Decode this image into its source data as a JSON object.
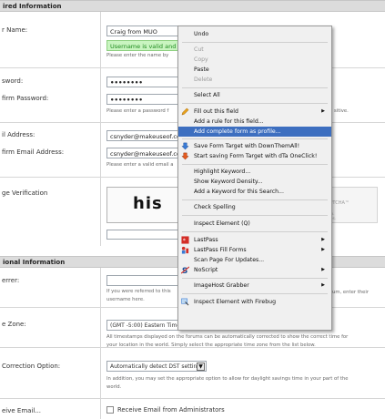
{
  "sections": {
    "required": "ired Information",
    "optional": "ional Information"
  },
  "fields": {
    "username": {
      "label": "r Name:",
      "value": "Craig from MUO",
      "valid": "Username is valid and",
      "hint": "Please enter the name by"
    },
    "password": {
      "label": "sword:",
      "value": "••••••••",
      "confirm_label": "firm Password:",
      "confirm_value": "••••••••",
      "hint": "Please enter a password f",
      "right_hint": "sitive."
    },
    "email": {
      "label": "il Address:",
      "value": "csnyder@makeuseof.com",
      "confirm_label": "firm Email Address:",
      "confirm_value": "csnyder@makeuseof.com",
      "hint": "Please enter a valid email a"
    },
    "image_verification": {
      "label": "ge Verification",
      "captcha_text": "his",
      "recaptcha_mark": "APTCHA™",
      "recaptcha_sub_1": "am.",
      "recaptcha_sub_2": "ikes."
    },
    "referrer": {
      "label": "errer:",
      "hint_1": "If you were referred to this",
      "hint_1_right": "um, enter their",
      "hint_2": "username here."
    },
    "timezone": {
      "label": "e Zone:",
      "value": "(GMT -5:00) Eastern Time (US & Canada), Bo",
      "hint_1": "All timestamps displayed on the forums can be automatically corrected to show the correct time for",
      "hint_2": "your location in the world. Simply select the appropriate time zone from the list below."
    },
    "dst": {
      "label": "Correction Option:",
      "value": "Automatically detect DST settings",
      "hint_1": "In addition, you may set the appropriate option to allow for daylight savings time in your part of the",
      "hint_2": "world."
    },
    "receive_email": {
      "label": "eive Email...",
      "checkbox_label": "Receive Email from Administrators"
    }
  },
  "context_menu": {
    "undo": "Undo",
    "cut": "Cut",
    "copy": "Copy",
    "paste": "Paste",
    "delete": "Delete",
    "select_all": "Select All",
    "fill_out": "Fill out this field",
    "add_rule": "Add a rule for this field...",
    "add_complete": "Add complete form as profile...",
    "save_form": "Save Form Target with DownThemAll!",
    "start_saving": "Start saving Form Target with dTa OneClick!",
    "highlight": "Highlight Keyword...",
    "density": "Show Keyword Density...",
    "add_keyword": "Add a Keyword for this Search...",
    "spelling": "Check Spelling",
    "inspect": "Inspect Element (Q)",
    "lastpass": "LastPass",
    "lastpass_fill": "LastPass Fill Forms",
    "scan": "Scan Page For Updates...",
    "noscript": "NoScript",
    "imagehost": "ImageHost Grabber",
    "firebug": "Inspect Element with Firebug"
  },
  "colors": {
    "menu_highlight": "#3d6fc0",
    "valid_bg": "#c9f5c0",
    "section_bg": "#dcdcdc"
  }
}
